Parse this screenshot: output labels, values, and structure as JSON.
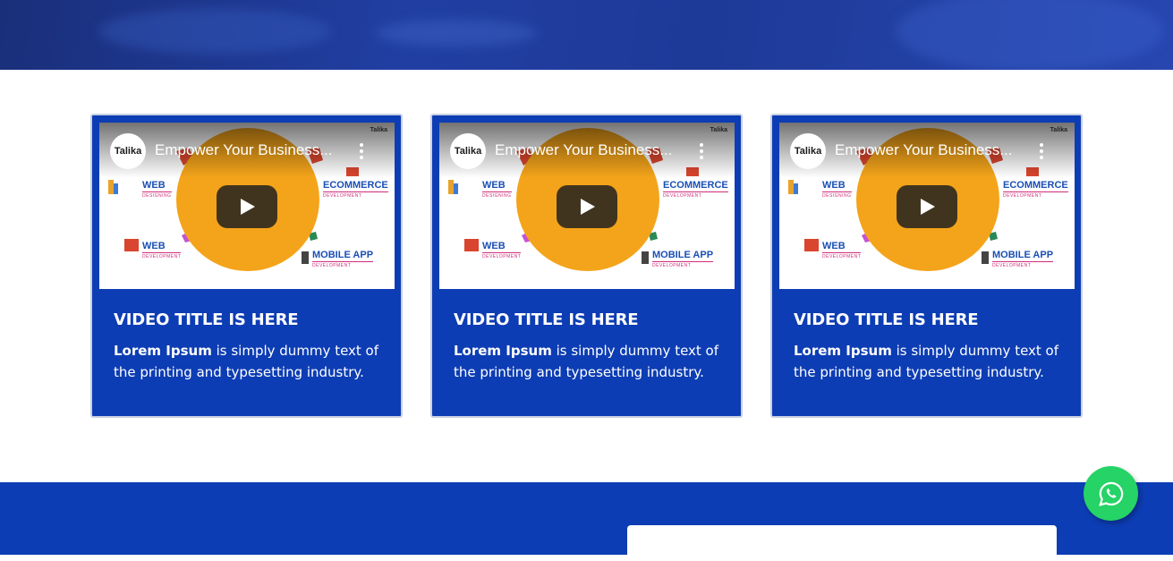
{
  "hero": {
    "overlay_color": "#213fa3"
  },
  "videos": [
    {
      "video_title": "Empower Your Business...",
      "channel_logo": "Talika",
      "brand_tag": "Talika",
      "services": [
        "WEB",
        "DESIGNING",
        "ECOMMERCE",
        "DEVELOPMENT",
        "WEB",
        "DEVELOPMENT",
        "MOBILE APP",
        "DEVELOPMENT"
      ],
      "card_title": "VIDEO TITLE IS HERE",
      "desc_bold": "Lorem Ipsum",
      "desc_rest": " is simply dummy text of the printing and typesetting industry."
    },
    {
      "video_title": "Empower Your Business...",
      "channel_logo": "Talika",
      "brand_tag": "Talika",
      "services": [
        "WEB",
        "DESIGNING",
        "ECOMMERCE",
        "DEVELOPMENT",
        "WEB",
        "DEVELOPMENT",
        "MOBILE APP",
        "DEVELOPMENT"
      ],
      "card_title": "VIDEO TITLE IS HERE",
      "desc_bold": "Lorem Ipsum",
      "desc_rest": " is simply dummy text of the printing and typesetting industry."
    },
    {
      "video_title": "Empower Your Business...",
      "channel_logo": "Talika",
      "brand_tag": "Talika",
      "services": [
        "WEB",
        "DESIGNING",
        "ECOMMERCE",
        "DEVELOPMENT",
        "WEB",
        "DEVELOPMENT",
        "MOBILE APP",
        "DEVELOPMENT"
      ],
      "card_title": "VIDEO TITLE IS HERE",
      "desc_bold": "Lorem Ipsum",
      "desc_rest": " is simply dummy text of the printing and typesetting industry."
    }
  ],
  "icons": {
    "play": "youtube-play-icon",
    "menu": "more-vertical-icon",
    "whatsapp": "whatsapp-icon"
  },
  "colors": {
    "card_bg": "#0d3db4",
    "footer_bg": "#0d3db4",
    "whatsapp": "#25d366",
    "play_circle": "#f4a41a"
  }
}
